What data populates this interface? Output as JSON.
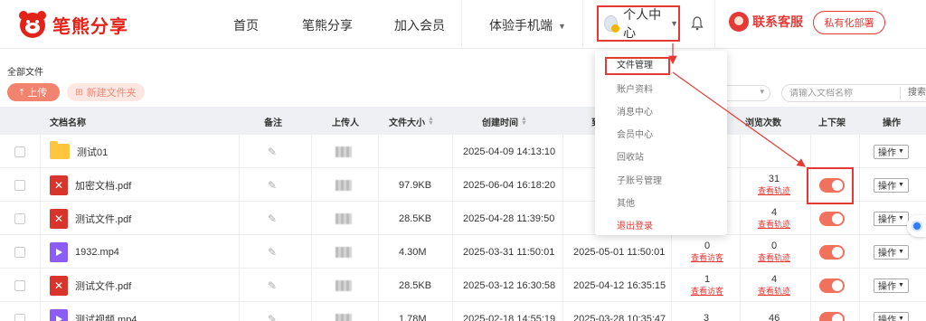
{
  "header": {
    "logo_text": "笔熊分享",
    "nav": [
      "首页",
      "笔熊分享",
      "加入会员",
      "体验手机端"
    ],
    "user_center_label": "个人中心",
    "service_label": "联系客服",
    "deploy_label": "私有化部署"
  },
  "toolbar": {
    "breadcrumb": "全部文件",
    "upload_label": "上传",
    "new_folder_label": "新建文件夹",
    "search_placeholder": "请输入文档名称",
    "search_button": "搜索"
  },
  "table": {
    "headers": [
      "文档名称",
      "备注",
      "上传人",
      "文件大小",
      "创建时间",
      "到",
      "浏览次数",
      "上下架",
      "操作"
    ],
    "rows": [
      {
        "name": "测试01",
        "type": "folder",
        "size": "",
        "created": "2025-04-09 14:13:10",
        "expire": "",
        "downloads": "",
        "views": "",
        "has_toggle": false,
        "op": "操作"
      },
      {
        "name": "加密文档.pdf",
        "type": "pdf",
        "size": "97.9KB",
        "created": "2025-06-04 16:18:20",
        "expire": "",
        "downloads": "",
        "views": "31",
        "views_link": "查看轨迹",
        "has_toggle": true,
        "op": "操作"
      },
      {
        "name": "测试文件.pdf",
        "type": "pdf",
        "size": "28.5KB",
        "created": "2025-04-28 11:39:50",
        "expire": "",
        "downloads": "",
        "views": "4",
        "views_link": "查看轨迹",
        "has_toggle": true,
        "op": "操作"
      },
      {
        "name": "1932.mp4",
        "type": "video",
        "size": "4.30M",
        "created": "2025-03-31 11:50:01",
        "expire": "2025-05-01 11:50:01",
        "downloads": "0",
        "downloads_link": "查看访客",
        "views": "0",
        "views_link": "查看轨迹",
        "has_toggle": true,
        "op": "操作"
      },
      {
        "name": "测试文件.pdf",
        "type": "pdf",
        "size": "28.5KB",
        "created": "2025-03-12 16:30:58",
        "expire": "2025-04-12 16:35:15",
        "downloads": "1",
        "downloads_link": "查看访客",
        "views": "4",
        "views_link": "查看轨迹",
        "has_toggle": true,
        "op": "操作"
      },
      {
        "name": "测试视频.mp4",
        "type": "video",
        "size": "1.78M",
        "created": "2025-02-18 14:55:19",
        "expire": "2025-03-28 10:35:47",
        "downloads": "3",
        "downloads_link": "",
        "views": "46",
        "views_link": "",
        "has_toggle": true,
        "op": "操作"
      }
    ]
  },
  "dropdown": {
    "items": [
      "文件管理",
      "账户资料",
      "消息中心",
      "会员中心",
      "回收站",
      "子账号管理",
      "其他",
      "退出登录"
    ]
  },
  "colors": {
    "brand_red": "#e53935",
    "toggle_on": "#f0715e",
    "upload_button": "#f1836f"
  },
  "icons": [
    "logo-bear-icon",
    "caret-down-icon",
    "user-avatar-icon",
    "bell-icon",
    "service-avatar-icon",
    "upload-icon",
    "folder-plus-icon",
    "folder-icon",
    "pdf-icon",
    "video-icon",
    "edit-icon",
    "sort-icon",
    "chat-fab-icon"
  ]
}
